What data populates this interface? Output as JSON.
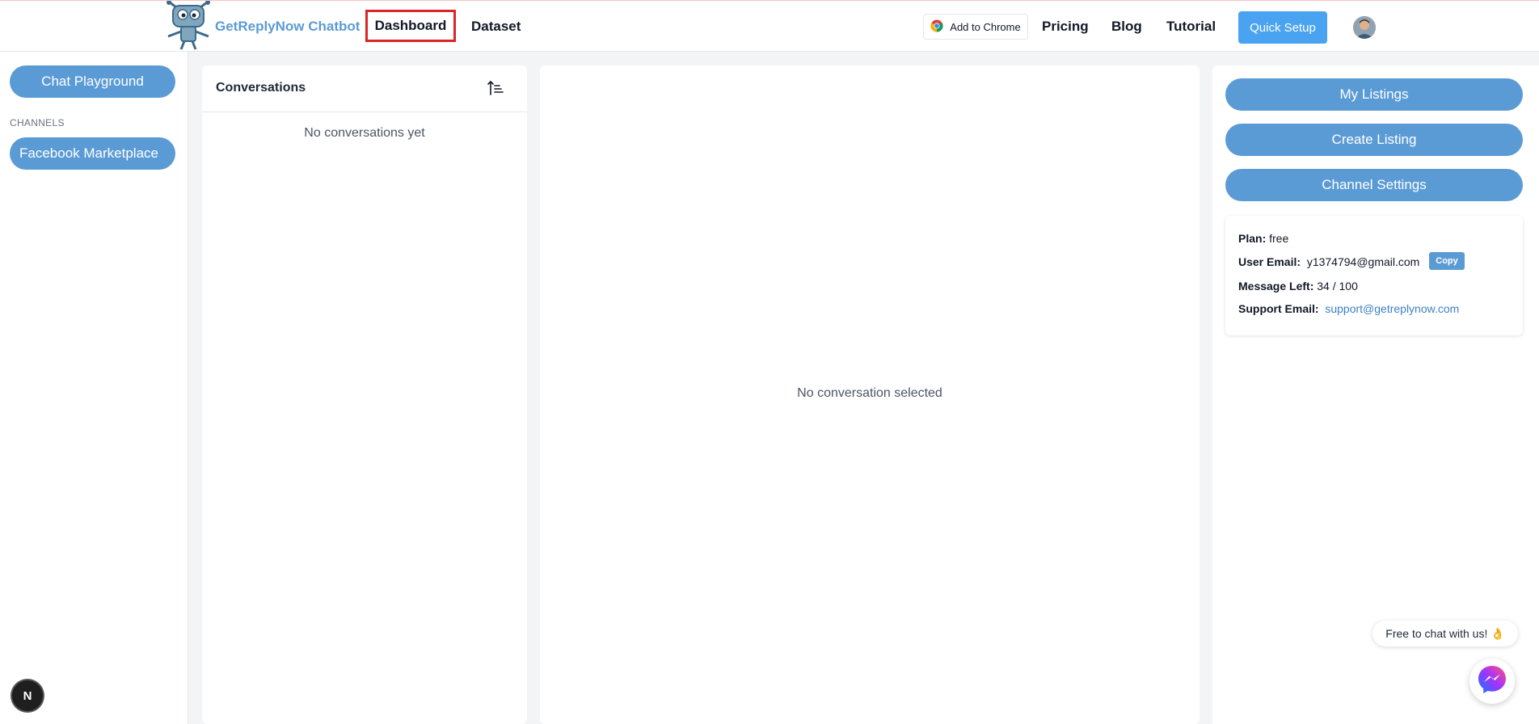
{
  "header": {
    "brand_name": "GetReplyNow Chatbot",
    "nav": {
      "dashboard": "Dashboard",
      "dataset": "Dataset",
      "pricing": "Pricing",
      "blog": "Blog",
      "tutorial": "Tutorial"
    },
    "add_to_chrome": "Add to Chrome",
    "quick_setup": "Quick Setup"
  },
  "sidebar": {
    "chat_playground": "Chat Playground",
    "channels_label": "CHANNELS",
    "channels": [
      "Facebook Marketplace"
    ],
    "n_badge": "N"
  },
  "conversations": {
    "title": "Conversations",
    "empty_text": "No conversations yet"
  },
  "chat": {
    "empty_text": "No conversation selected"
  },
  "right_panel": {
    "buttons": {
      "my_listings": "My Listings",
      "create_listing": "Create Listing",
      "channel_settings": "Channel Settings"
    },
    "info": {
      "plan_label": "Plan:",
      "plan_value": "free",
      "user_email_label": "User Email:",
      "user_email_value": "y1374794@gmail.com",
      "copy_label": "Copy",
      "message_left_label": "Message Left:",
      "message_left_value": "34 / 100",
      "support_email_label": "Support Email:",
      "support_email_value": "support@getreplynow.com"
    }
  },
  "chat_widget": {
    "bubble_text": "Free to chat with us! 👌"
  },
  "colors": {
    "accent": "#5b9bd5",
    "quick_setup": "#4aa3f0",
    "highlight_border": "#d92626"
  }
}
